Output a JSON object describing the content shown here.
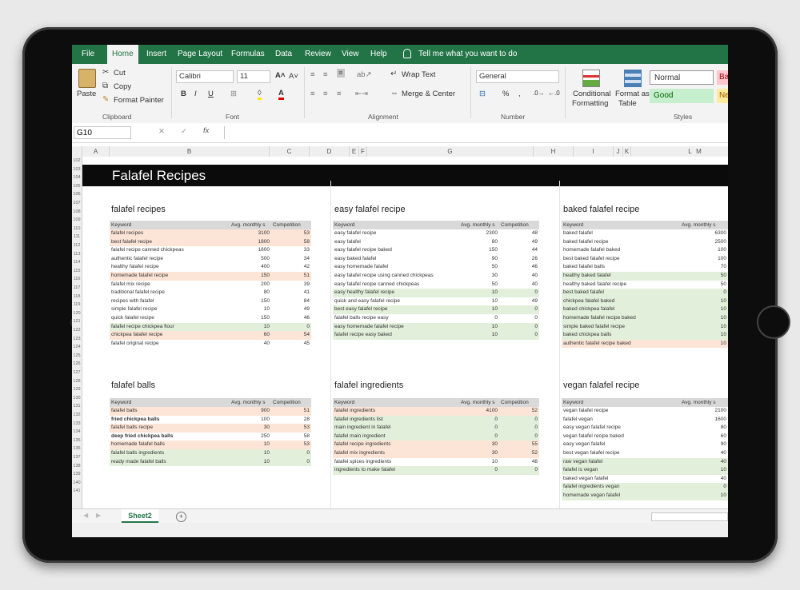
{
  "ribbon": {
    "tabs": [
      "File",
      "Home",
      "Insert",
      "Page Layout",
      "Formulas",
      "Data",
      "Review",
      "View",
      "Help"
    ],
    "tell_me": "Tell me what you want to do",
    "clipboard": {
      "paste": "Paste",
      "cut": "Cut",
      "copy": "Copy",
      "format_painter": "Format Painter",
      "group": "Clipboard"
    },
    "font": {
      "name": "Calibri",
      "size": "11",
      "group": "Font"
    },
    "alignment": {
      "wrap": "Wrap Text",
      "merge": "Merge & Center",
      "group": "Alignment"
    },
    "number": {
      "format": "General",
      "group": "Number"
    },
    "styles": {
      "conditional": "Conditional",
      "formatting": "Formatting",
      "format_as": "Format as",
      "table": "Table",
      "normal": "Normal",
      "good": "Good",
      "bad": "Ba",
      "neutral": "Ne",
      "group": "Styles"
    }
  },
  "formula_bar": {
    "name_box": "G10",
    "fx": "fx"
  },
  "columns": [
    "A",
    "B",
    "C",
    "D",
    "E",
    "F",
    "G",
    "H",
    "I",
    "J",
    "K",
    "L",
    "M"
  ],
  "rows": [
    "102",
    "103",
    "104",
    "105",
    "106",
    "107",
    "108",
    "109",
    "110",
    "111",
    "112",
    "113",
    "114",
    "115",
    "116",
    "117",
    "118",
    "119",
    "120",
    "121",
    "122",
    "123",
    "124",
    "125",
    "126",
    "127",
    "128",
    "129",
    "130",
    "131",
    "132",
    "133",
    "134",
    "135",
    "136",
    "137",
    "138",
    "139",
    "140",
    "141"
  ],
  "sheet": {
    "title": "Falafel Recipes",
    "tables": [
      {
        "title": "falafel recipes",
        "headers": [
          "Keyword",
          "Avg. monthly s",
          "Competition"
        ],
        "rows": [
          {
            "k": "falafel recipes",
            "v": "3100",
            "c": "53",
            "h": "r"
          },
          {
            "k": "best falafel recipe",
            "v": "1800",
            "c": "58",
            "h": "r"
          },
          {
            "k": "falafel recipe canned chickpeas",
            "v": "1600",
            "c": "33",
            "h": ""
          },
          {
            "k": "authentic falafel recipe",
            "v": "500",
            "c": "34",
            "h": ""
          },
          {
            "k": "healthy falafel recipe",
            "v": "400",
            "c": "42",
            "h": ""
          },
          {
            "k": "homemade falafel recipe",
            "v": "150",
            "c": "51",
            "h": "r"
          },
          {
            "k": "falafel mix recipe",
            "v": "200",
            "c": "39",
            "h": ""
          },
          {
            "k": "traditional falafel recipe",
            "v": "80",
            "c": "41",
            "h": ""
          },
          {
            "k": "recipes with falafel",
            "v": "150",
            "c": "84",
            "h": ""
          },
          {
            "k": "simple falafel recipe",
            "v": "10",
            "c": "49",
            "h": ""
          },
          {
            "k": "quick falafel recipe",
            "v": "150",
            "c": "46",
            "h": ""
          },
          {
            "k": "falafel recipe chickpea flour",
            "v": "10",
            "c": "0",
            "h": "g"
          },
          {
            "k": "chickpea falafel recipe",
            "v": "60",
            "c": "54",
            "h": "r"
          },
          {
            "k": "falafel original recipe",
            "v": "40",
            "c": "45",
            "h": ""
          }
        ]
      },
      {
        "title": "easy falafel recipe",
        "headers": [
          "Keyword",
          "Avg. monthly s",
          "Competition"
        ],
        "rows": [
          {
            "k": "easy falafel recipe",
            "v": "2300",
            "c": "48",
            "h": ""
          },
          {
            "k": "easy falafel",
            "v": "80",
            "c": "49",
            "h": ""
          },
          {
            "k": "easy falafel recipe baked",
            "v": "150",
            "c": "44",
            "h": ""
          },
          {
            "k": "easy baked falafel",
            "v": "90",
            "c": "26",
            "h": ""
          },
          {
            "k": "easy homemade falafel",
            "v": "50",
            "c": "46",
            "h": ""
          },
          {
            "k": "easy falafel recipe using canned chickpeas",
            "v": "30",
            "c": "40",
            "h": ""
          },
          {
            "k": "easy falafel recipe canned chickpeas",
            "v": "50",
            "c": "40",
            "h": ""
          },
          {
            "k": "easy healthy falafel recipe",
            "v": "10",
            "c": "0",
            "h": "g"
          },
          {
            "k": "quick and easy falafel recipe",
            "v": "10",
            "c": "49",
            "h": ""
          },
          {
            "k": "best easy falafel recipe",
            "v": "10",
            "c": "0",
            "h": "g"
          },
          {
            "k": "falafel balls recipe easy",
            "v": "0",
            "c": "0",
            "h": ""
          },
          {
            "k": "easy homemade falafel recipe",
            "v": "10",
            "c": "0",
            "h": "g"
          },
          {
            "k": "falafel recipe easy baked",
            "v": "10",
            "c": "0",
            "h": "g"
          }
        ]
      },
      {
        "title": "baked falafel recipe",
        "headers": [
          "Keyword",
          "Avg. monthly s"
        ],
        "rows": [
          {
            "k": "baked falafel",
            "v": "6300",
            "h": ""
          },
          {
            "k": "baked falafel recipe",
            "v": "2500",
            "h": ""
          },
          {
            "k": "homemade falafel baked",
            "v": "100",
            "h": ""
          },
          {
            "k": "best baked falafel recipe",
            "v": "100",
            "h": ""
          },
          {
            "k": "baked falafel balls",
            "v": "70",
            "h": ""
          },
          {
            "k": "healthy baked falafel",
            "v": "50",
            "h": "g"
          },
          {
            "k": "healthy baked falafel recipe",
            "v": "50",
            "h": ""
          },
          {
            "k": "best baked falafel",
            "v": "0",
            "h": "g"
          },
          {
            "k": "chickpea falafel baked",
            "v": "10",
            "h": "g"
          },
          {
            "k": "baked chickpea falafel",
            "v": "10",
            "h": "g"
          },
          {
            "k": "homemade falafel recipe baked",
            "v": "10",
            "h": "g"
          },
          {
            "k": "simple baked falafel recipe",
            "v": "10",
            "h": "g"
          },
          {
            "k": "baked chickpea balls",
            "v": "10",
            "h": "g"
          },
          {
            "k": "authentic falafel recipe baked",
            "v": "10",
            "h": "r"
          }
        ]
      },
      {
        "title": "falafel balls",
        "headers": [
          "Keyword",
          "Avg. monthly s",
          "Competition"
        ],
        "rows": [
          {
            "k": "falafel balls",
            "v": "900",
            "c": "51",
            "h": "r"
          },
          {
            "k": "fried chickpea balls",
            "v": "100",
            "c": "28",
            "h": "",
            "b": true
          },
          {
            "k": "falafel balls recipe",
            "v": "30",
            "c": "53",
            "h": "r"
          },
          {
            "k": "deep fried chickpea balls",
            "v": "250",
            "c": "58",
            "h": "",
            "b": true
          },
          {
            "k": "homemade falafel balls",
            "v": "10",
            "c": "53",
            "h": "r"
          },
          {
            "k": "falafel balls ingredients",
            "v": "10",
            "c": "0",
            "h": "g"
          },
          {
            "k": "ready made falafel balls",
            "v": "10",
            "c": "0",
            "h": "g"
          }
        ]
      },
      {
        "title": "falafel ingredients",
        "headers": [
          "Keyword",
          "Avg. monthly s",
          "Competition"
        ],
        "rows": [
          {
            "k": "falafel ingredients",
            "v": "4100",
            "c": "52",
            "h": "r"
          },
          {
            "k": "falafel ingredients list",
            "v": "0",
            "c": "0",
            "h": "g"
          },
          {
            "k": "main ingredient in falafel",
            "v": "0",
            "c": "0",
            "h": "g"
          },
          {
            "k": "falafel main ingredient",
            "v": "0",
            "c": "0",
            "h": "g"
          },
          {
            "k": "falafel recipe ingredients",
            "v": "30",
            "c": "55",
            "h": "r"
          },
          {
            "k": "falafel mix ingredients",
            "v": "30",
            "c": "52",
            "h": "r"
          },
          {
            "k": "falafel spices ingredients",
            "v": "10",
            "c": "48",
            "h": ""
          },
          {
            "k": "ingredients to make falafel",
            "v": "0",
            "c": "0",
            "h": "g"
          }
        ]
      },
      {
        "title": "vegan falafel recipe",
        "headers": [
          "Keyword",
          "Avg. monthly s"
        ],
        "rows": [
          {
            "k": "vegan falafel recipe",
            "v": "2100",
            "h": ""
          },
          {
            "k": "falafel vegan",
            "v": "1600",
            "h": ""
          },
          {
            "k": "easy vegan falafel recipe",
            "v": "80",
            "h": ""
          },
          {
            "k": "vegan falafel recipe baked",
            "v": "60",
            "h": ""
          },
          {
            "k": "easy vegan falafel",
            "v": "90",
            "h": ""
          },
          {
            "k": "best vegan falafel recipe",
            "v": "40",
            "h": ""
          },
          {
            "k": "raw vegan falafel",
            "v": "40",
            "h": "g"
          },
          {
            "k": "falafel is vegan",
            "v": "10",
            "h": "g"
          },
          {
            "k": "baked vegan falafel",
            "v": "40",
            "h": ""
          },
          {
            "k": "falafel ingredients vegan",
            "v": "0",
            "h": "g"
          },
          {
            "k": "homemade vegan falafel",
            "v": "10",
            "h": "g"
          }
        ]
      }
    ]
  },
  "sheet_tabs": {
    "active": "Sheet2",
    "add": "+"
  },
  "colors": {
    "excel_green": "#217346",
    "highlight_red": "#fce4d6",
    "highlight_green": "#e2efda",
    "header_gray": "#d9d9d9",
    "title_band": "#0b0b0b"
  }
}
